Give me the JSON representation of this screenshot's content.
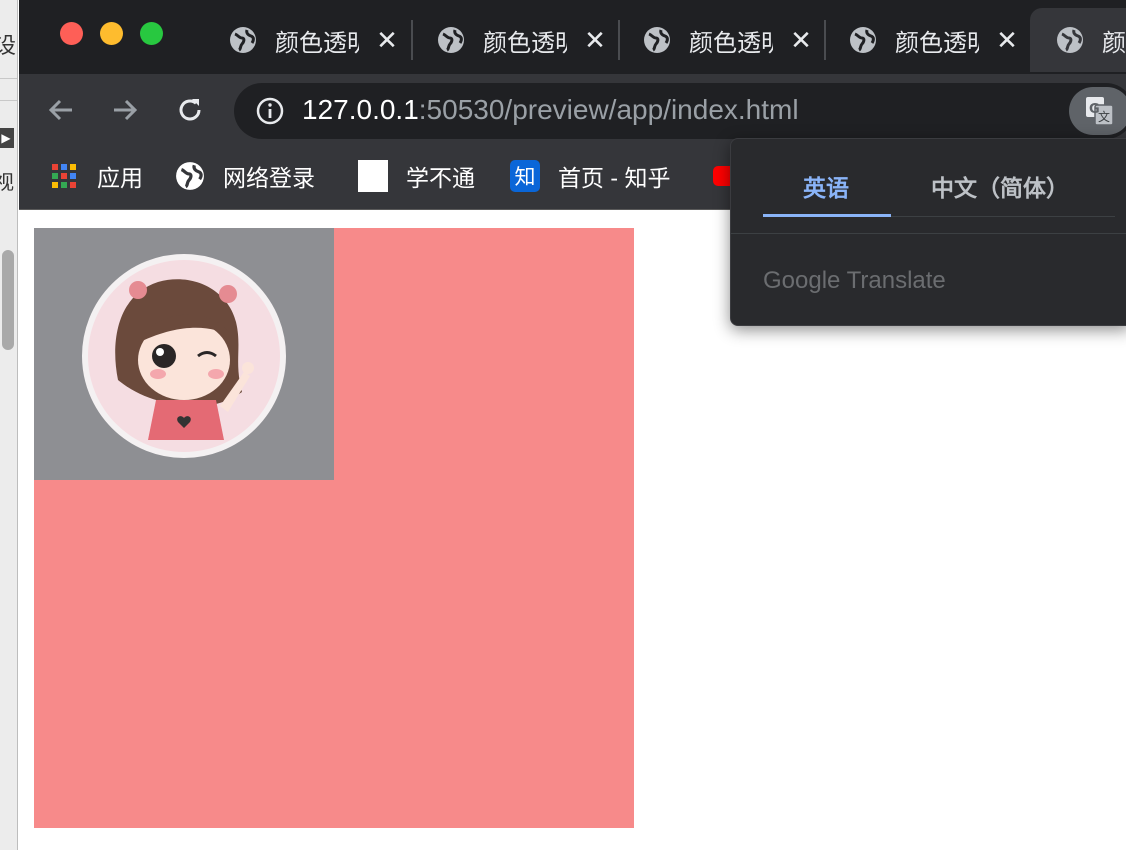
{
  "tabs": [
    {
      "title": "颜色透明"
    },
    {
      "title": "颜色透明"
    },
    {
      "title": "颜色透明"
    },
    {
      "title": "颜色透明"
    },
    {
      "title": "颜色透明"
    }
  ],
  "toolbar": {
    "url_host": "127.0.0.1",
    "url_rest": ":50530/preview/app/index.html"
  },
  "bookmarks": [
    {
      "label": "应用",
      "icon": "apps-grid-icon"
    },
    {
      "label": "网络登录",
      "icon": "globe-icon"
    },
    {
      "label": "学不通",
      "icon": "white-square-icon"
    },
    {
      "label": "首页 - 知乎",
      "icon": "zhihu-icon",
      "icon_text": "知"
    },
    {
      "label": "",
      "icon": "youtube-icon"
    }
  ],
  "translate_popup": {
    "tab_source": "英语",
    "tab_target": "中文（简体）",
    "brand": "Google Translate"
  },
  "background_window": {
    "text_top": "设",
    "text_bottom": "视"
  },
  "colors": {
    "pink_box": "#f78a8a",
    "gray_box": "#8e8f93",
    "accent": "#8ab4f8"
  }
}
